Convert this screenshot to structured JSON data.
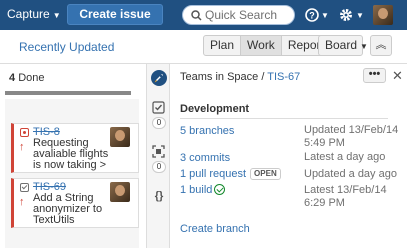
{
  "topbar": {
    "capture_label": "Capture",
    "create_issue_label": "Create issue",
    "search_placeholder": "Quick Search",
    "colors": {
      "header_bg": "#205081",
      "primary_button": "#3572b0"
    }
  },
  "subbar": {
    "recently_updated": "Recently Updated",
    "modes": [
      "Plan",
      "Work",
      "Report"
    ],
    "active_mode": "Work",
    "board_label": "Board",
    "collapse_icon": "double-chevron-up-icon"
  },
  "column": {
    "count": "4",
    "name": "Done",
    "progress": 1.0
  },
  "cards": [
    {
      "key": "TIS-8",
      "summary": "Requesting avaliable flights is now taking >",
      "type_icon": "bug-icon",
      "type_color": "#d04437",
      "priority_icon": "arrow-up-icon"
    },
    {
      "key": "TIS-69",
      "summary": "Add a String anonymizer to TextUtils",
      "type_icon": "task-icon",
      "type_color": "#707070",
      "priority_icon": "arrow-up-icon"
    }
  ],
  "rail": {
    "counts": [
      "0",
      "0"
    ],
    "icons": [
      "project-avatar-icon",
      "subtasks-icon",
      "screenshot-icon",
      "code-icon"
    ]
  },
  "detail": {
    "project": "Teams in Space",
    "separator": "/",
    "issue_key": "TIS-67",
    "more_label": "•••",
    "section_title": "Development",
    "rows": [
      {
        "link": "5 branches",
        "meta": [
          "Updated 13/Feb/14",
          "5:49 PM"
        ]
      },
      {
        "link": "3 commits",
        "meta": [
          "Latest a day ago"
        ]
      },
      {
        "link": "1 pull request",
        "badge": "OPEN",
        "meta": [
          "Updated a day ago"
        ]
      },
      {
        "link": "1 build",
        "meta": [
          "Latest 13/Feb/14",
          "6:29 PM"
        ]
      }
    ],
    "create_branch": "Create branch"
  }
}
